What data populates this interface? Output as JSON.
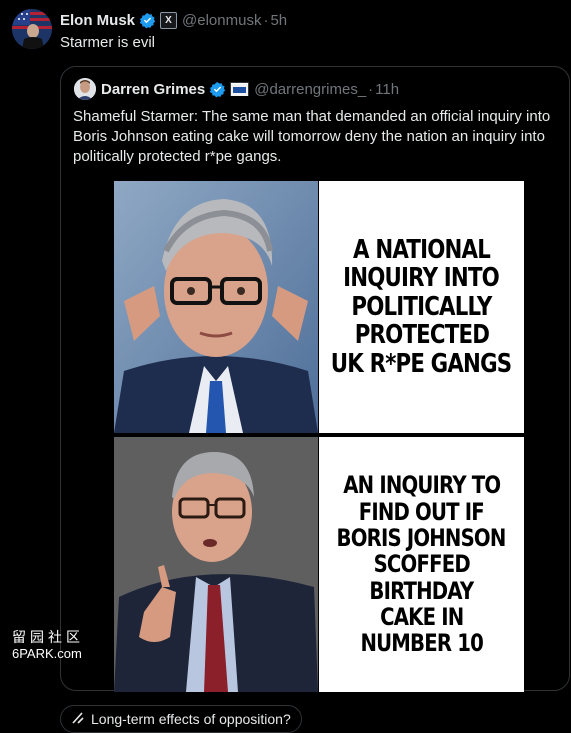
{
  "post": {
    "author_name": "Elon Musk",
    "author_handle": "@elonmusk",
    "time": "5h",
    "affiliate_badge": "X",
    "text": "Starmer is evil"
  },
  "quote": {
    "author_name": "Darren Grimes",
    "author_handle": "@darrengrimes_",
    "time": "11h",
    "text": "Shameful Starmer: The same man that demanded an official inquiry into Boris Johnson eating cake will tomorrow deny the nation an inquiry into politically protected r*pe gangs.",
    "meme": {
      "top_lines": [
        "A NATIONAL",
        "INQUIRY INTO",
        "POLITICALLY",
        "PROTECTED",
        "UK R*PE GANGS"
      ],
      "bottom_lines": [
        "AN INQUIRY TO",
        "FIND OUT IF",
        "BORIS JOHNSON",
        "SCOFFED",
        "BIRTHDAY",
        "CAKE IN",
        "NUMBER 10"
      ]
    }
  },
  "watermark": {
    "chinese": "留园社区",
    "site": "6PARK.com"
  },
  "community_note": {
    "icon": "grok-icon",
    "label": "Long-term effects of opposition?"
  },
  "colors": {
    "background": "#000000",
    "text": "#e7e9ea",
    "muted": "#71767b",
    "verified": "#1d9bf0",
    "border": "#2f3336"
  }
}
